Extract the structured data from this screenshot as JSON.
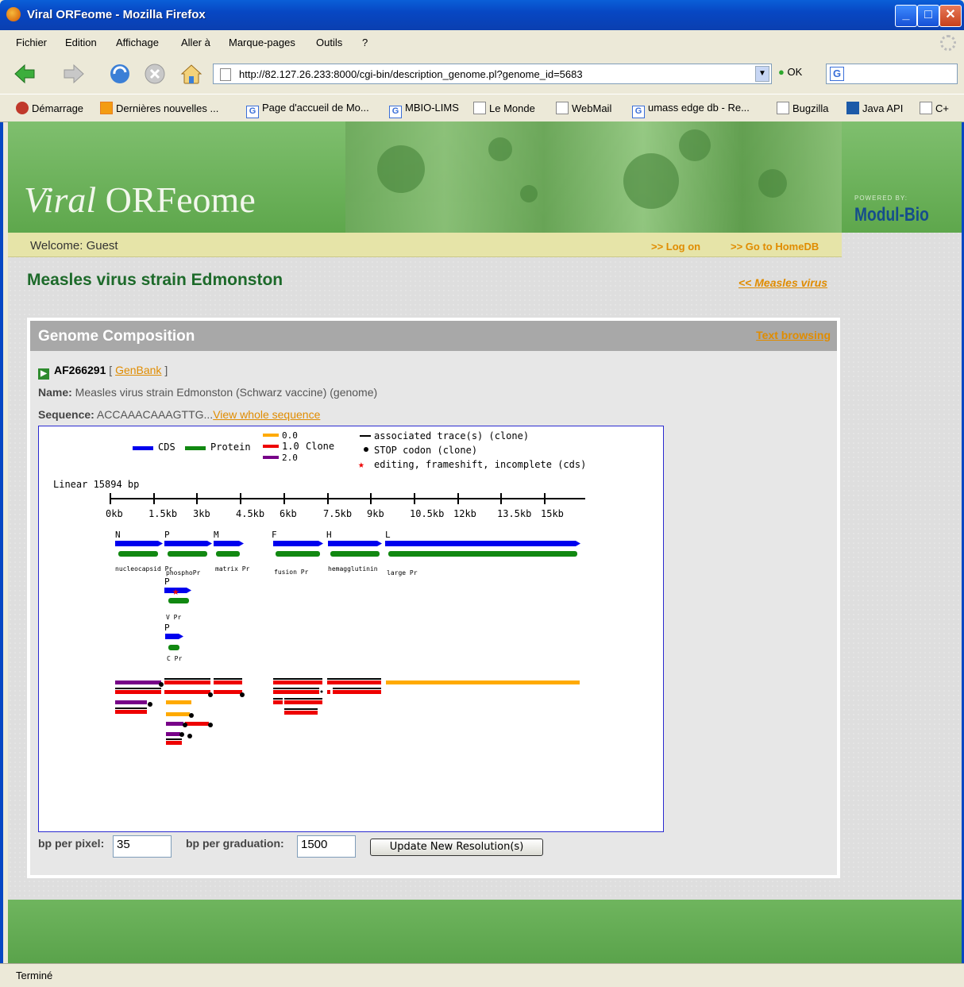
{
  "window": {
    "title": "Viral ORFeome - Mozilla Firefox"
  },
  "menu": [
    "Fichier",
    "Edition",
    "Affichage",
    "Aller à",
    "Marque-pages",
    "Outils",
    "?"
  ],
  "nav": {
    "url": "http://82.127.26.233:8000/cgi-bin/description_genome.pl?genome_id=5683",
    "go_label": "OK"
  },
  "bookmarks": [
    {
      "label": "Démarrage",
      "icon": "firefox-icon"
    },
    {
      "label": "Dernières nouvelles ...",
      "icon": "rss-icon"
    },
    {
      "label": "Page d'accueil de Mo...",
      "icon": "google-icon"
    },
    {
      "label": "MBIO-LIMS",
      "icon": "google-icon"
    },
    {
      "label": "Le Monde",
      "icon": "page-icon"
    },
    {
      "label": "WebMail",
      "icon": "page-icon"
    },
    {
      "label": "umass edge db - Re...",
      "icon": "google-icon"
    },
    {
      "label": "Bugzilla",
      "icon": "page-icon"
    },
    {
      "label": "Java API",
      "icon": "sun-icon"
    },
    {
      "label": "C+",
      "icon": "page-icon"
    }
  ],
  "banner": {
    "logo_italic": "Viral",
    "logo_rest": " ORFeome",
    "powered": "POWERED BY:",
    "brand": "Modul-Bio"
  },
  "welcome": {
    "text": "Welcome: Guest",
    "logon": ">> Log on",
    "homedb": ">> Go to HomeDB"
  },
  "page": {
    "title": "Measles virus strain Edmonston",
    "back": "<< Measles virus"
  },
  "panel": {
    "title": "Genome Composition",
    "text_browsing": "Text browsing",
    "accession": "AF266291",
    "genbank": "GenBank",
    "name_label": "Name:",
    "name_value": " Measles virus strain Edmonston (Schwarz vaccine) (genome)",
    "seq_label": "Sequence:",
    "seq_value": " ACCAAACAAAGTTG...",
    "view_seq": "View whole sequence"
  },
  "graph": {
    "legend": {
      "cds": "CDS",
      "protein": "Protein",
      "clone": "Clone",
      "c0": "0.0",
      "c1": "1.0",
      "c2": "2.0",
      "trace": "associated trace(s) (clone)",
      "stop": "STOP codon (clone)",
      "edit": "editing, frameshift, incomplete (cds)"
    },
    "linear": "Linear 15894 bp",
    "ticks": [
      "0kb",
      "1.5kb",
      "3kb",
      "4.5kb",
      "6kb",
      "7.5kb",
      "9kb",
      "10.5kb",
      "12kb",
      "13.5kb",
      "15kb"
    ],
    "genes": [
      "N",
      "P",
      "M",
      "F",
      "H",
      "L",
      "P",
      "P"
    ],
    "proteins": [
      "nucleocapsid Pr",
      "phosphoPr",
      "matrix Pr",
      "fusion Pr",
      "hemagglutinin",
      "large Pr",
      "V Pr",
      "C Pr"
    ]
  },
  "controls": {
    "bp_pixel_label": "bp per pixel:",
    "bp_pixel": "35",
    "bp_grad_label": "bp per graduation:",
    "bp_grad": "1500",
    "update": "Update New Resolution(s)"
  },
  "status": "Terminé",
  "colors": {
    "cds": "#0000ee",
    "protein": "#118811",
    "clone0": "#ffaa00",
    "clone1": "#ee0000",
    "clone2": "#770088",
    "link": "#e08c00"
  }
}
